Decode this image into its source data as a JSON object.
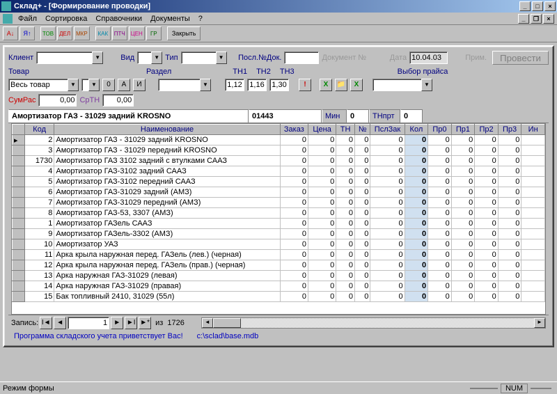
{
  "window": {
    "title": "Склад+ - [Формирование проводки]"
  },
  "menu": {
    "file": "Файл",
    "sort": "Сортировка",
    "ref": "Справочники",
    "docs": "Документы",
    "help": "?"
  },
  "toolbar": {
    "close": "Закрыть"
  },
  "labels": {
    "client": "Клиент",
    "vid": "Вид",
    "tip": "Тип",
    "posldok": "Посл.№Док.",
    "docnum": "Документ №",
    "date": "Дата",
    "prim": "Прим.",
    "tovar": "Товар",
    "razdel": "Раздел",
    "tn1": "ТН1",
    "tn2": "ТН2",
    "tn3": "ТН3",
    "vyborprice": "Выбор прайса",
    "sumras": "СумРас",
    "srtn": "СрТН",
    "min": "Мин",
    "tnprt": "ТНпрт",
    "zapis": "Запись:",
    "iz": "из"
  },
  "fields": {
    "tovar_combo": "Весь товар",
    "date": "10.04.03",
    "tn1": "1,12",
    "tn2": "1,16",
    "tn3": "1,30",
    "sumras": "0,00",
    "srtn": "0,00",
    "min": "0",
    "tnprt": "0",
    "prod_name": "Амортизатор ГАЗ - 31029 задний KROSNO",
    "prod_code": "01443",
    "process_btn": "Провести",
    "btn0": "0",
    "btnA": "А",
    "btnI": "И"
  },
  "nav": {
    "current": "1",
    "total": "1726"
  },
  "status": {
    "program": "Программа складского учета приветствует Вас!",
    "path": "c:\\sclad\\base.mdb"
  },
  "footer": {
    "mode": "Режим формы",
    "num": "NUM"
  },
  "columns": [
    "",
    "Код",
    "Наименование",
    "Заказ",
    "Цена",
    "ТН",
    "№",
    "ПслЗак",
    "Кол",
    "Пр0",
    "Пр1",
    "Пр2",
    "Пр3",
    "Ин"
  ],
  "rows": [
    {
      "kod": "2",
      "name": "Амортизатор ГАЗ - 31029 задний KROSNO",
      "zakaz": "0",
      "cena": "0",
      "tn": "0",
      "n": "0",
      "pslzak": "0",
      "kol": "0",
      "pr0": "0",
      "pr1": "0",
      "pr2": "0",
      "pr3": "0"
    },
    {
      "kod": "3",
      "name": "Амортизатор ГАЗ - 31029 передний KROSNO",
      "zakaz": "0",
      "cena": "0",
      "tn": "0",
      "n": "0",
      "pslzak": "0",
      "kol": "0",
      "pr0": "0",
      "pr1": "0",
      "pr2": "0",
      "pr3": "0"
    },
    {
      "kod": "1730",
      "name": "Амортизатор ГАЗ 3102 задний с втулками СААЗ",
      "zakaz": "0",
      "cena": "0",
      "tn": "0",
      "n": "0",
      "pslzak": "0",
      "kol": "0",
      "pr0": "0",
      "pr1": "0",
      "pr2": "0",
      "pr3": "0"
    },
    {
      "kod": "4",
      "name": "Амортизатор ГАЗ-3102 задний СААЗ",
      "zakaz": "0",
      "cena": "0",
      "tn": "0",
      "n": "0",
      "pslzak": "0",
      "kol": "0",
      "pr0": "0",
      "pr1": "0",
      "pr2": "0",
      "pr3": "0"
    },
    {
      "kod": "5",
      "name": "Амортизатор ГАЗ-3102 передний СААЗ",
      "zakaz": "0",
      "cena": "0",
      "tn": "0",
      "n": "0",
      "pslzak": "0",
      "kol": "0",
      "pr0": "0",
      "pr1": "0",
      "pr2": "0",
      "pr3": "0"
    },
    {
      "kod": "6",
      "name": "Амортизатор ГАЗ-31029 задний (АМЗ)",
      "zakaz": "0",
      "cena": "0",
      "tn": "0",
      "n": "0",
      "pslzak": "0",
      "kol": "0",
      "pr0": "0",
      "pr1": "0",
      "pr2": "0",
      "pr3": "0"
    },
    {
      "kod": "7",
      "name": "Амортизатор ГАЗ-31029 передний (АМЗ)",
      "zakaz": "0",
      "cena": "0",
      "tn": "0",
      "n": "0",
      "pslzak": "0",
      "kol": "0",
      "pr0": "0",
      "pr1": "0",
      "pr2": "0",
      "pr3": "0"
    },
    {
      "kod": "8",
      "name": "Амортизатор ГАЗ-53, 3307 (АМЗ)",
      "zakaz": "0",
      "cena": "0",
      "tn": "0",
      "n": "0",
      "pslzak": "0",
      "kol": "0",
      "pr0": "0",
      "pr1": "0",
      "pr2": "0",
      "pr3": "0"
    },
    {
      "kod": "1",
      "name": "Амортизатор ГАЗель СААЗ",
      "zakaz": "0",
      "cena": "0",
      "tn": "0",
      "n": "0",
      "pslzak": "0",
      "kol": "0",
      "pr0": "0",
      "pr1": "0",
      "pr2": "0",
      "pr3": "0"
    },
    {
      "kod": "9",
      "name": "Амортизатор ГАЗель-3302 (АМЗ)",
      "zakaz": "0",
      "cena": "0",
      "tn": "0",
      "n": "0",
      "pslzak": "0",
      "kol": "0",
      "pr0": "0",
      "pr1": "0",
      "pr2": "0",
      "pr3": "0"
    },
    {
      "kod": "10",
      "name": "Амортизатор УАЗ",
      "zakaz": "0",
      "cena": "0",
      "tn": "0",
      "n": "0",
      "pslzak": "0",
      "kol": "0",
      "pr0": "0",
      "pr1": "0",
      "pr2": "0",
      "pr3": "0"
    },
    {
      "kod": "11",
      "name": "Арка крыла наружная перед. ГАЗель (лев.) (черная)",
      "zakaz": "0",
      "cena": "0",
      "tn": "0",
      "n": "0",
      "pslzak": "0",
      "kol": "0",
      "pr0": "0",
      "pr1": "0",
      "pr2": "0",
      "pr3": "0"
    },
    {
      "kod": "12",
      "name": "Арка крыла наружная перед. ГАЗель (прав.) (черная)",
      "zakaz": "0",
      "cena": "0",
      "tn": "0",
      "n": "0",
      "pslzak": "0",
      "kol": "0",
      "pr0": "0",
      "pr1": "0",
      "pr2": "0",
      "pr3": "0"
    },
    {
      "kod": "13",
      "name": "Арка наружная ГАЗ-31029 (левая)",
      "zakaz": "0",
      "cena": "0",
      "tn": "0",
      "n": "0",
      "pslzak": "0",
      "kol": "0",
      "pr0": "0",
      "pr1": "0",
      "pr2": "0",
      "pr3": "0"
    },
    {
      "kod": "14",
      "name": "Арка наружная ГАЗ-31029 (правая)",
      "zakaz": "0",
      "cena": "0",
      "tn": "0",
      "n": "0",
      "pslzak": "0",
      "kol": "0",
      "pr0": "0",
      "pr1": "0",
      "pr2": "0",
      "pr3": "0"
    },
    {
      "kod": "15",
      "name": "Бак топливный  2410, 31029 (55л)",
      "zakaz": "0",
      "cena": "0",
      "tn": "0",
      "n": "0",
      "pslzak": "0",
      "kol": "0",
      "pr0": "0",
      "pr1": "0",
      "pr2": "0",
      "pr3": "0"
    }
  ]
}
